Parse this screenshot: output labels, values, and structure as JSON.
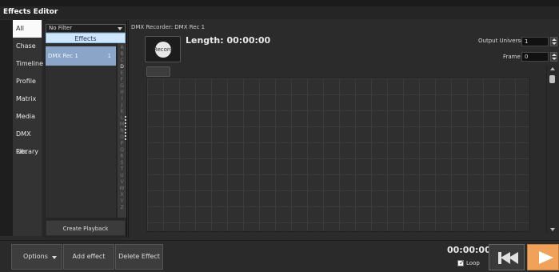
{
  "window": {
    "title": "Effects Editor"
  },
  "nav": {
    "items": [
      {
        "label": "All",
        "active": true
      },
      {
        "label": "Chase",
        "active": false
      },
      {
        "label": "Timeline",
        "active": false
      },
      {
        "label": "Profile",
        "active": false
      },
      {
        "label": "Matrix",
        "active": false
      },
      {
        "label": "Media",
        "active": false
      },
      {
        "label": "DMX Rec",
        "active": false
      },
      {
        "label": "Library",
        "active": false
      }
    ]
  },
  "effects": {
    "filter": "No Filter",
    "header": "Effects",
    "items": [
      {
        "name": "DMX Rec 1",
        "count": "1"
      }
    ],
    "alphabet": [
      "A",
      "B",
      "C",
      "D",
      "E",
      "F",
      "G",
      "H",
      "I",
      "J",
      "K",
      "L",
      "M",
      "N",
      "O",
      "P",
      "Q",
      "R",
      "S",
      "T",
      "U",
      "V",
      "W",
      "X",
      "Y",
      "Z"
    ],
    "highlighted_letter": "D",
    "create_playback": "Create Playback"
  },
  "recorder": {
    "title": "DMX Recorder: DMX Rec 1",
    "record_label": "Record",
    "length_label": "Length: 00:00:00",
    "output_universe_label": "Output Universe",
    "output_universe_value": "1",
    "frame_label": "Frame",
    "frame_value": "0"
  },
  "footer": {
    "options_label": "Options",
    "add_effect_label": "Add effect",
    "delete_effect_label": "Delete Effect",
    "time": "00:00:00",
    "loop_label": "Loop",
    "loop_checked": true
  },
  "colors": {
    "accent_play": "#f0a25a",
    "selected_row": "#8aa5c7",
    "header_fill": "#cfe6ff"
  },
  "icons": {
    "record": "record-icon",
    "rewind": "rewind-icon",
    "play": "play-icon"
  }
}
